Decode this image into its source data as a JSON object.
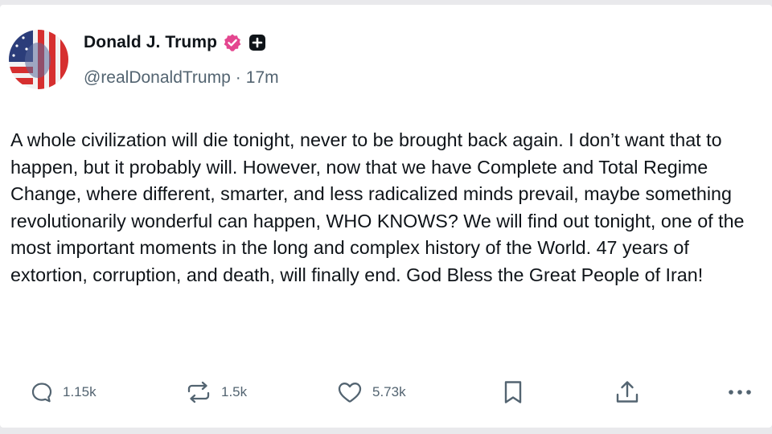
{
  "post": {
    "author": {
      "display_name": "Donald J. Trump",
      "handle": "@realDonaldTrump",
      "verified_icon": "verified-badge-icon",
      "extra_badge_icon": "plus-badge-icon"
    },
    "time_separator": "·",
    "timestamp": "17m",
    "text": "A whole civilization will die tonight, never to be brought back again. I don’t want that to happen, but it probably will. However, now that we have Complete and Total Regime Change, where different, smarter, and less radicalized minds prevail, maybe something revolutionarily wonderful can happen, WHO KNOWS? We will find out tonight, one of the most important moments in the long and complex history of the World. 47 years of extortion, corruption, and death, will finally end. God Bless the Great People of Iran!"
  },
  "actions": {
    "reply": {
      "icon": "reply-icon",
      "count": "1.15k"
    },
    "repost": {
      "icon": "repost-icon",
      "count": "1.5k"
    },
    "like": {
      "icon": "heart-icon",
      "count": "5.73k"
    },
    "bookmark": {
      "icon": "bookmark-icon"
    },
    "share": {
      "icon": "share-icon"
    },
    "more": {
      "icon": "more-icon"
    }
  },
  "colors": {
    "text_primary": "#0f1419",
    "text_secondary": "#536471",
    "verified_badge": "#e4468f",
    "background": "#ffffff"
  }
}
